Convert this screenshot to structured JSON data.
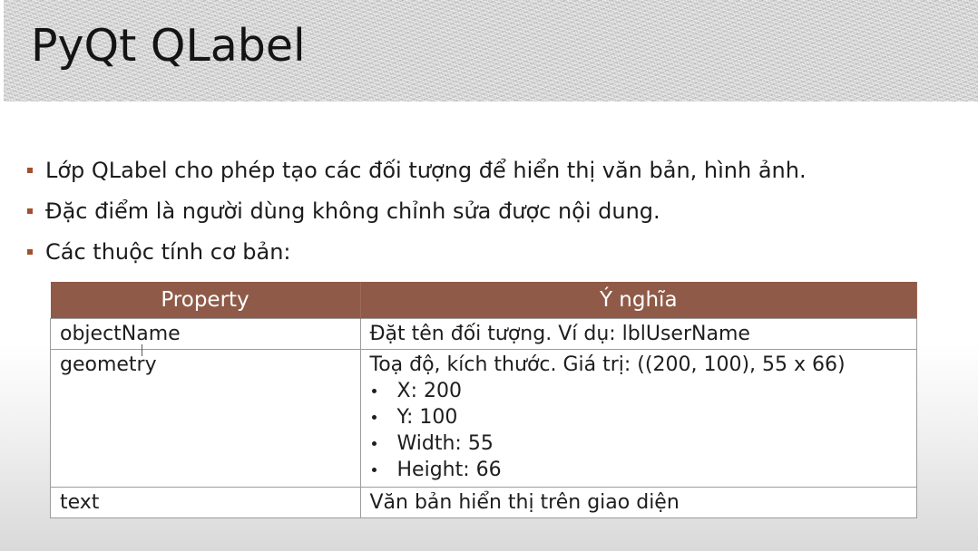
{
  "slide": {
    "title": "PyQt QLabel",
    "accent_color": "#8f5b48",
    "bullet_color": "#a0522d",
    "bullets": [
      "Lớp QLabel cho phép tạo các đối tượng để hiển thị văn bản, hình ảnh.",
      "Đặc điểm là người dùng không chỉnh sửa được nội dung.",
      "Các thuộc tính cơ bản:"
    ]
  },
  "table": {
    "headers": [
      "Property",
      "Ý nghĩa"
    ],
    "rows": [
      {
        "name": "objectName",
        "desc": "Đặt tên đối tượng. Ví dụ: lblUserName",
        "items": []
      },
      {
        "name": "geometry",
        "desc": "Toạ độ, kích thước. Giá trị: ((200, 100), 55 x 66)",
        "items": [
          "X: 200",
          "Y: 100",
          "Width: 55",
          "Height: 66"
        ]
      },
      {
        "name": "text",
        "desc": "Văn bản hiển thị trên giao diện",
        "items": []
      }
    ]
  }
}
